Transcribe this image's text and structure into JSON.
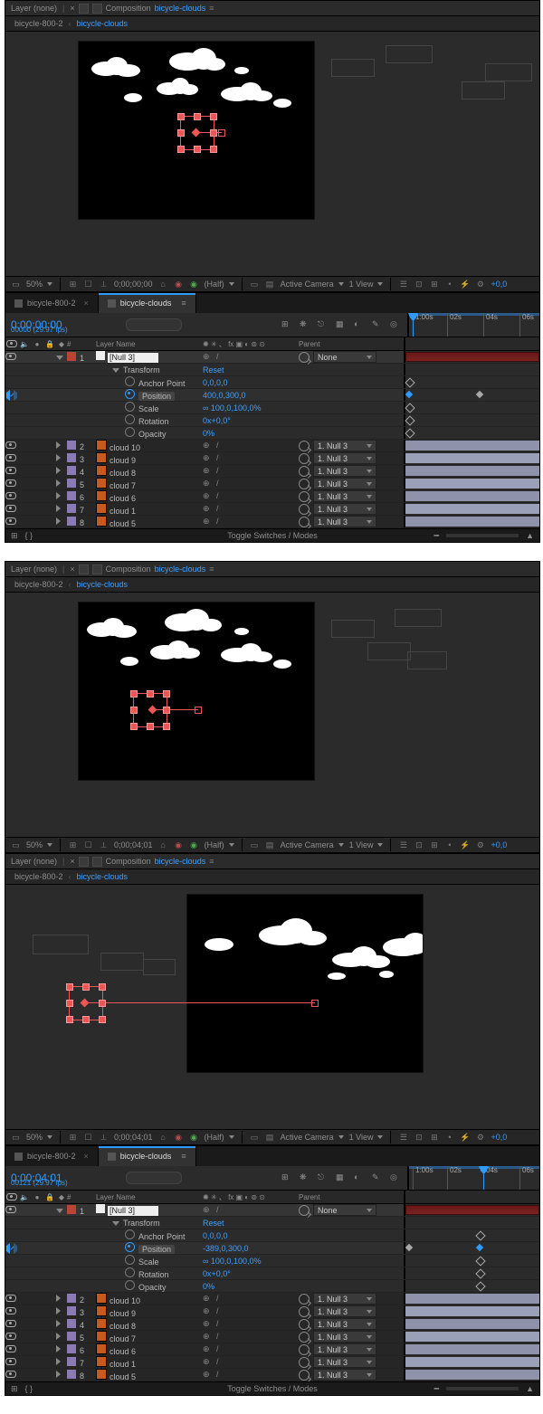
{
  "viewer": {
    "tabs": {
      "layer_label": "Layer (none)",
      "comp_label": "Composition",
      "comp_name": "bicycle-clouds"
    },
    "crumb": {
      "root": "bicycle-800-2",
      "current": "bicycle-clouds"
    },
    "toolbar": {
      "zoom": "50%",
      "snapshot": "snapshot",
      "timecode1": "0;00;00;00",
      "timecode2": "0;00;04;01",
      "res": "(Half)",
      "camera": "Active Camera",
      "views": "1 View",
      "exposure": "+0,0"
    }
  },
  "timeline": {
    "tabs": {
      "alt": "bicycle-800-2",
      "active": "bicycle-clouds"
    },
    "head1": {
      "timecode": "0;00;00;00",
      "frame_fps": "00000 (29.97 fps)"
    },
    "head2": {
      "timecode": "0;00;04;01",
      "frame_fps": "00121 (29.97 fps)"
    },
    "cols": {
      "idx": "#",
      "name": "Layer Name",
      "parent": "Parent"
    },
    "ruler": {
      "ticks": [
        "1:00s",
        "02s",
        "04s",
        "06s"
      ]
    },
    "switches_label": "Toggle Switches / Modes",
    "null_layer": {
      "idx": "1",
      "name": "[Null 3]",
      "parent": "None"
    },
    "transform": {
      "label": "Transform",
      "reset": "Reset",
      "anchor": {
        "label": "Anchor Point",
        "val": "0,0,0,0"
      },
      "position1": {
        "label": "Position",
        "val": "400,0,300,0"
      },
      "position2": {
        "label": "Position",
        "val": "-389,0,300,0"
      },
      "scale": {
        "label": "Scale",
        "val": "∞ 100,0,100,0%"
      },
      "rotation": {
        "label": "Rotation",
        "val": "0x+0,0°"
      },
      "opacity": {
        "label": "Opacity",
        "val": "0%"
      }
    },
    "layers": [
      {
        "idx": "2",
        "name": "cloud 10",
        "parent": "1. Null 3"
      },
      {
        "idx": "3",
        "name": "cloud 9",
        "parent": "1. Null 3"
      },
      {
        "idx": "4",
        "name": "cloud 8",
        "parent": "1. Null 3"
      },
      {
        "idx": "5",
        "name": "cloud 7",
        "parent": "1. Null 3"
      },
      {
        "idx": "6",
        "name": "cloud 6",
        "parent": "1. Null 3"
      },
      {
        "idx": "7",
        "name": "cloud 1",
        "parent": "1. Null 3"
      },
      {
        "idx": "8",
        "name": "cloud 5",
        "parent": "1. Null 3"
      }
    ]
  }
}
